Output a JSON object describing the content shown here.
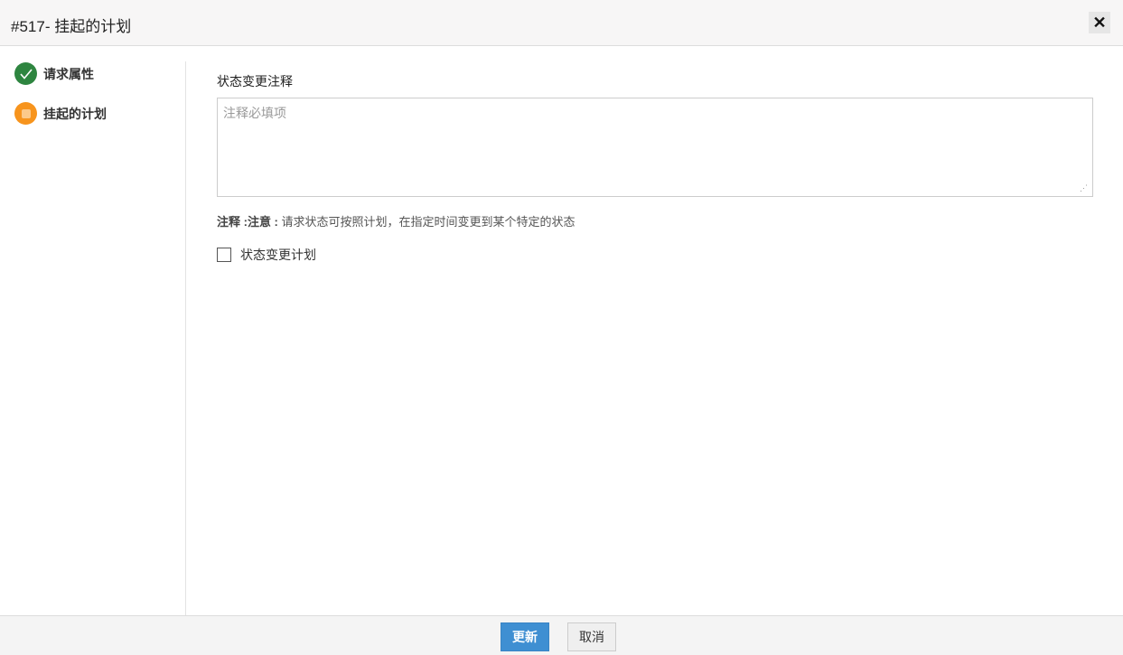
{
  "header": {
    "title": "#517- 挂起的计划",
    "close_icon": "✕"
  },
  "steps": [
    {
      "label": "请求属性",
      "state": "done",
      "color": "#2e8540"
    },
    {
      "label": "挂起的计划",
      "state": "current",
      "color": "#f7941d"
    }
  ],
  "form": {
    "comment_label": "状态变更注释",
    "comment_placeholder": "注释必填项",
    "comment_value": "",
    "note_prefix": "注释 :注意 :",
    "note_text": " 请求状态可按照计划，在指定时间变更到某个特定的状态",
    "schedule_checkbox_label": "状态变更计划",
    "schedule_checked": false
  },
  "footer": {
    "update_label": "更新",
    "cancel_label": "取消"
  }
}
